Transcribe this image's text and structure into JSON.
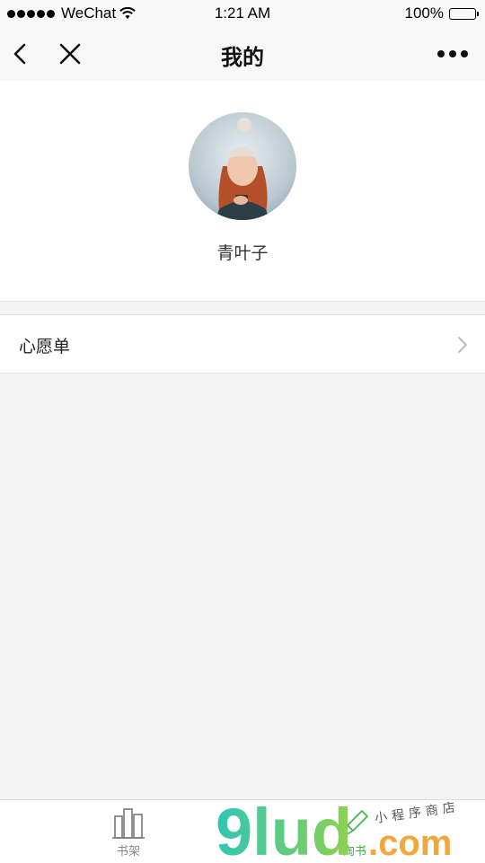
{
  "status_bar": {
    "carrier": "WeChat",
    "time": "1:21 AM",
    "battery": "100%"
  },
  "nav": {
    "title": "我的",
    "back_icon": "chevron-left-icon",
    "close_icon": "close-icon",
    "more_icon": "more-dots-icon"
  },
  "profile": {
    "username": "青叶子"
  },
  "menu": {
    "wishlist_label": "心愿单"
  },
  "tabbar": {
    "tabs": [
      {
        "label": "书架",
        "icon": "bookshelf-icon"
      },
      {
        "label": "淘书",
        "icon": "book-store-icon"
      }
    ]
  },
  "watermark": {
    "brand": "9lud",
    "domain": ".com",
    "slogan": "小程序商店"
  },
  "colors": {
    "accent_green": "#39b54a",
    "background": "#f4f4f4"
  }
}
